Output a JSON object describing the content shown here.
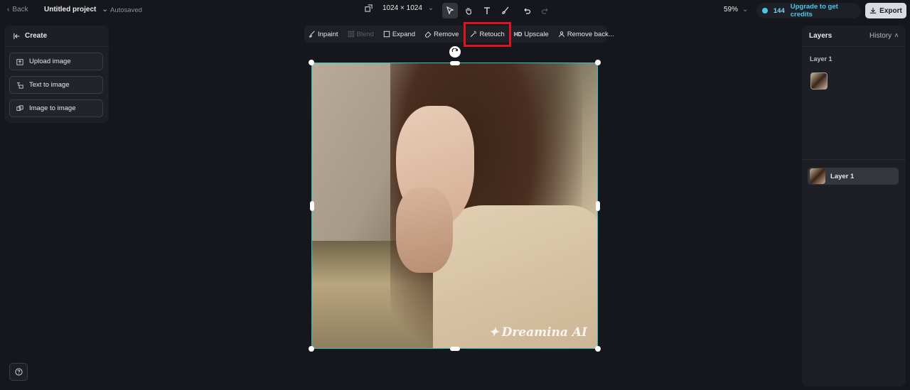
{
  "topbar": {
    "back_label": "Back",
    "project_title": "Untitled project",
    "autosaved": "Autosaved",
    "canvas_size": "1024 × 1024",
    "zoom": "59%",
    "credits": "144",
    "upgrade_label": "Upgrade to get credits",
    "export_label": "Export"
  },
  "left_panel": {
    "title": "Create",
    "buttons": [
      "Upload image",
      "Text to image",
      "Image to image"
    ]
  },
  "edit_tools": {
    "inpaint": "Inpaint",
    "blend": "Blend",
    "expand": "Expand",
    "remove": "Remove",
    "retouch": "Retouch",
    "upscale": "Upscale",
    "remove_bg": "Remove back..."
  },
  "canvas": {
    "watermark": "Dreamina AI"
  },
  "right_panel": {
    "tab_layers": "Layers",
    "tab_history": "History",
    "section_label": "Layer 1",
    "layer_name": "Layer 1"
  },
  "colors": {
    "accent": "#4cc6ea",
    "selection": "#2bc4c8",
    "highlight": "#e0141e"
  }
}
